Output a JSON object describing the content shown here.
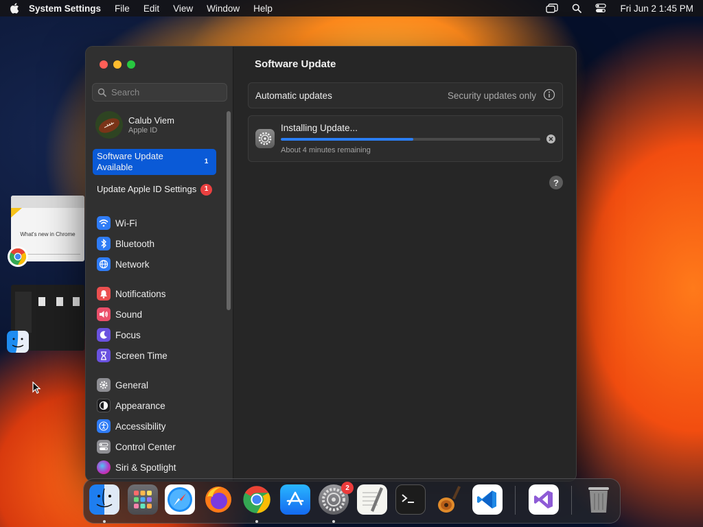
{
  "menubar": {
    "app_name": "System Settings",
    "menus": [
      "File",
      "Edit",
      "View",
      "Window",
      "Help"
    ],
    "clock": "Fri Jun 2  1:45 PM"
  },
  "sidebar": {
    "search_placeholder": "Search",
    "profile": {
      "name": "Calub Viem",
      "subtitle": "Apple ID"
    },
    "notices": [
      {
        "label": "Software Update Available",
        "badge": "1"
      },
      {
        "label": "Update Apple ID Settings",
        "badge": "1"
      }
    ],
    "items": [
      {
        "label": "Wi-Fi",
        "icon": "wifi-icon",
        "color": "#2f7cf6"
      },
      {
        "label": "Bluetooth",
        "icon": "bluetooth-icon",
        "color": "#2f7cf6"
      },
      {
        "label": "Network",
        "icon": "globe-icon",
        "color": "#2f7cf6"
      },
      {
        "label": "Notifications",
        "icon": "bell-icon",
        "color": "#eb4f4f"
      },
      {
        "label": "Sound",
        "icon": "speaker-icon",
        "color": "#eb4f6a"
      },
      {
        "label": "Focus",
        "icon": "moon-icon",
        "color": "#6a52e0"
      },
      {
        "label": "Screen Time",
        "icon": "hourglass-icon",
        "color": "#6a52e0"
      },
      {
        "label": "General",
        "icon": "gear-icon",
        "color": "#8e8e93"
      },
      {
        "label": "Appearance",
        "icon": "appearance-icon",
        "color": "#1c1c1e"
      },
      {
        "label": "Accessibility",
        "icon": "accessibility-icon",
        "color": "#2f7cf6"
      },
      {
        "label": "Control Center",
        "icon": "control-center-icon",
        "color": "#8e8e93"
      },
      {
        "label": "Siri & Spotlight",
        "icon": "siri-icon",
        "color": "#b43ac9"
      }
    ]
  },
  "content": {
    "title": "Software Update",
    "automatic_updates": {
      "label": "Automatic updates",
      "value": "Security updates only"
    },
    "update": {
      "title": "Installing Update...",
      "progress": 0.51,
      "remaining": "About 4 minutes remaining"
    },
    "help": "?"
  },
  "dock": {
    "apps": [
      "Finder",
      "Launchpad",
      "Safari",
      "Firefox",
      "Google Chrome",
      "App Store",
      "System Settings",
      "TextEdit",
      "Terminal",
      "GarageBand",
      "Visual Studio Code",
      "Visual Studio",
      "Trash"
    ],
    "system_settings_badge": "2"
  },
  "stage_manager": {
    "chrome_text": "What's new in Chrome"
  }
}
